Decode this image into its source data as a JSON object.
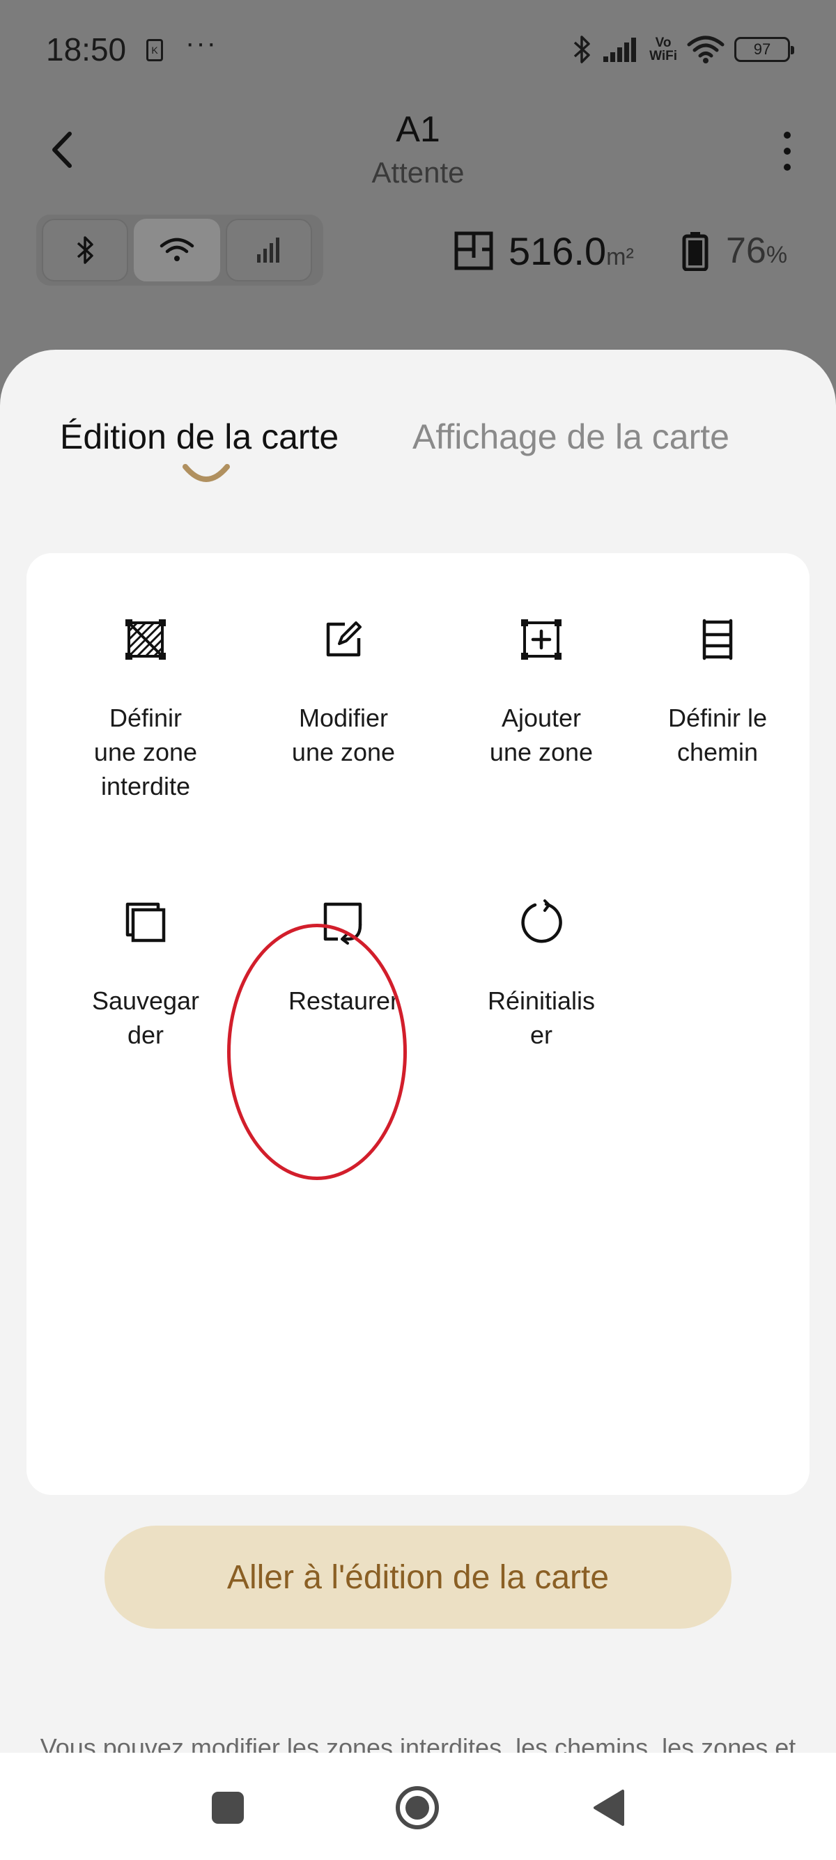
{
  "status_bar": {
    "time": "18:50",
    "sim_label": "K",
    "more": "···",
    "volte_top": "Vo",
    "volte_bottom": "WiFi",
    "battery": "97"
  },
  "header": {
    "title": "A1",
    "subtitle": "Attente"
  },
  "stats": {
    "area_value": "516.0",
    "area_unit": "m²",
    "battery_value": "76",
    "battery_unit": "%"
  },
  "tabs": [
    {
      "label": "Édition de la carte",
      "active": true
    },
    {
      "label": "Affichage de la carte",
      "active": false
    }
  ],
  "tools": [
    {
      "label": "Définir\nune zone\ninterdite",
      "icon": "no-go-zone-icon"
    },
    {
      "label": "Modifier\nune zone",
      "icon": "edit-zone-icon"
    },
    {
      "label": "Ajouter\nune zone",
      "icon": "add-zone-icon"
    },
    {
      "label": "Définir le\nchemin",
      "icon": "path-icon"
    },
    {
      "label": "Sauvegar\nder",
      "icon": "save-map-icon"
    },
    {
      "label": "Restaurer",
      "icon": "restore-icon"
    },
    {
      "label": "Réinitialis\ner",
      "icon": "reset-icon"
    }
  ],
  "cta_label": "Aller à l'édition de la carte",
  "hint": "Vous pouvez modifier les zones interdites, les chemins, les zones et d'autres éléments sur la carte.",
  "colors": {
    "accent": "#b0905f",
    "cta_bg": "#ece0c4",
    "cta_text": "#8a5f24",
    "highlight": "#d21e2b"
  }
}
